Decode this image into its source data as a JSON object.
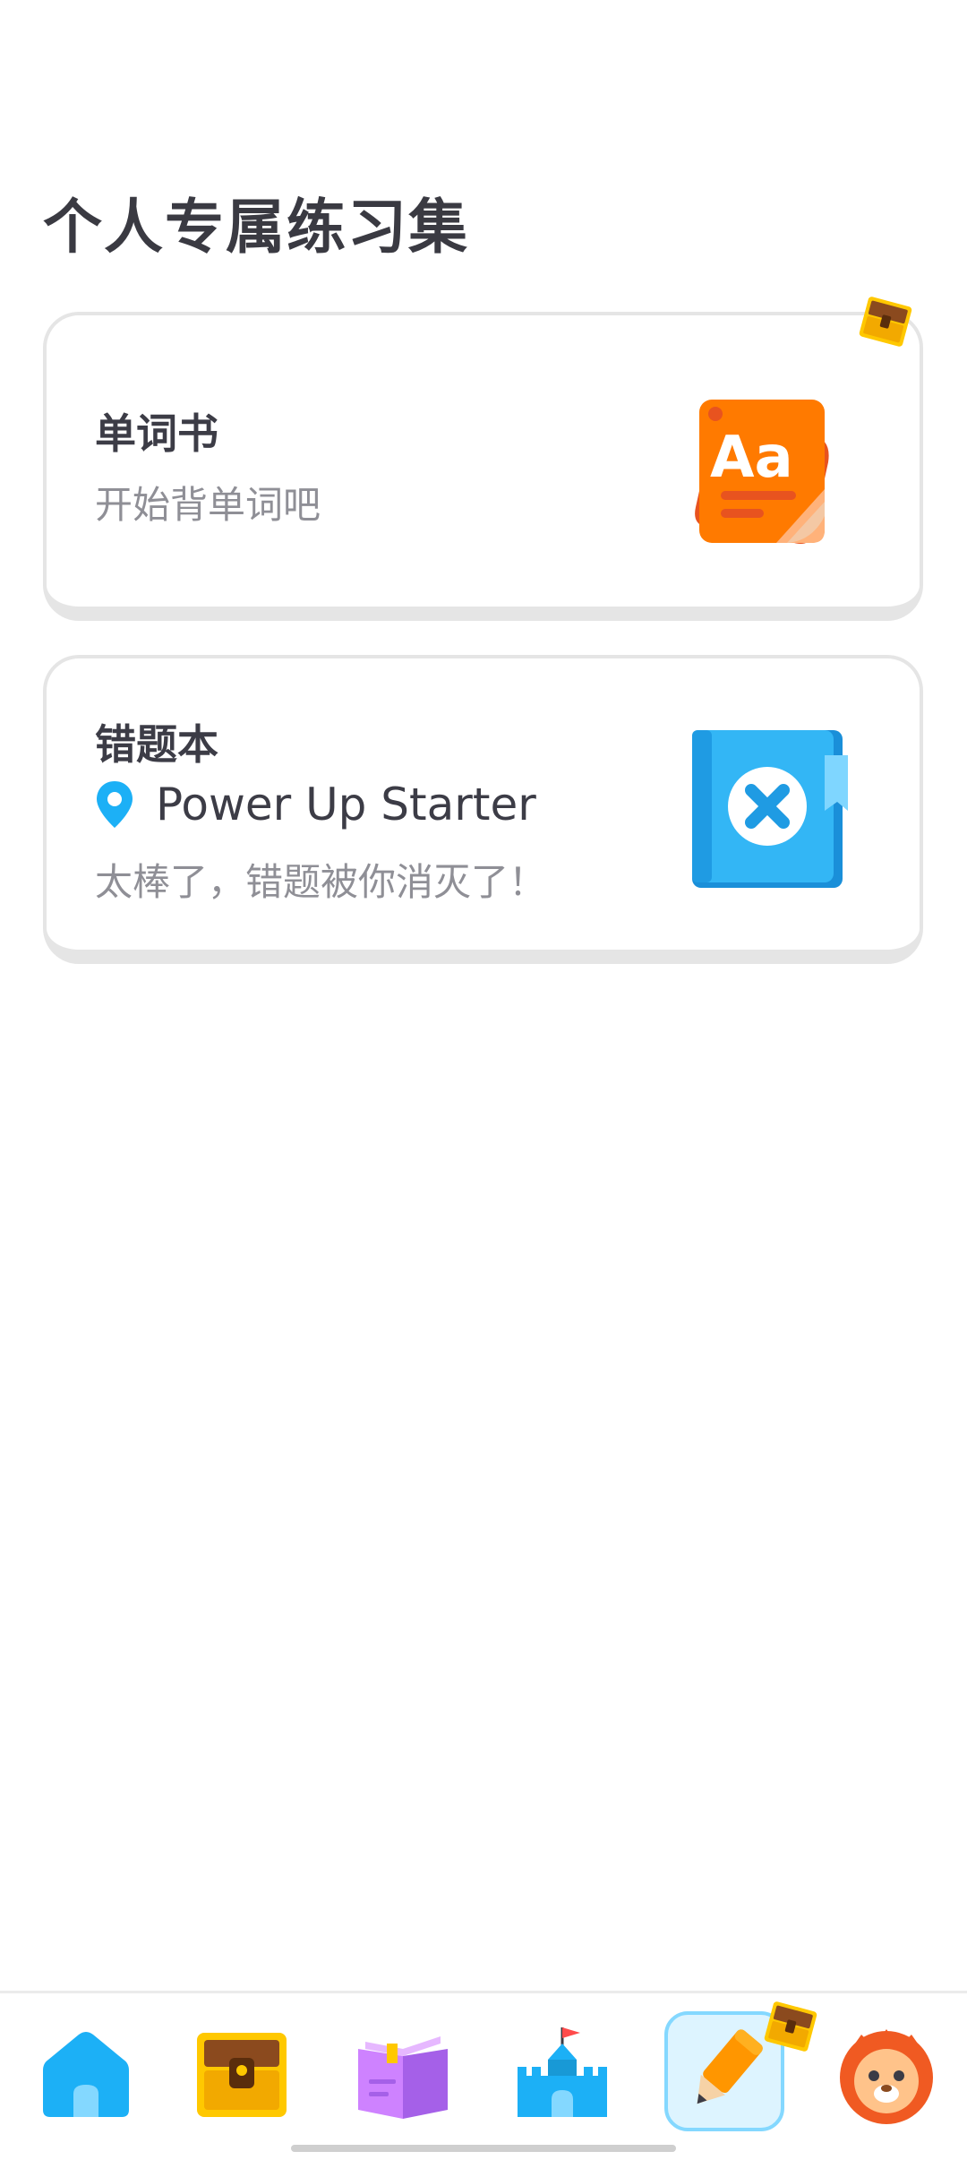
{
  "page": {
    "title": "个人专属练习集"
  },
  "cards": {
    "wordbook": {
      "title": "单词书",
      "subtitle": "开始背单词吧",
      "icon": "aa-wordbook-icon",
      "badge_icon": "chest-icon"
    },
    "mistakes": {
      "title": "错题本",
      "location": "Power Up Starter",
      "location_icon": "map-pin-icon",
      "subtitle": "太棒了，错题被你消灭了！",
      "icon": "mistake-notebook-icon"
    }
  },
  "nav": {
    "items": [
      {
        "name": "home",
        "icon": "home-icon"
      },
      {
        "name": "chest",
        "icon": "chest-icon"
      },
      {
        "name": "stories",
        "icon": "book-icon"
      },
      {
        "name": "leagues",
        "icon": "castle-icon"
      },
      {
        "name": "practice",
        "icon": "pencil-icon",
        "selected": true
      },
      {
        "name": "profile",
        "icon": "lion-avatar-icon"
      }
    ]
  },
  "colors": {
    "accent_blue": "#1cb0f6",
    "selected_bg": "#ddf4ff",
    "selected_border": "#84d8ff",
    "card_border": "#e5e5e5",
    "subtitle_gray": "#8f8f96",
    "orange": "#ff7a00",
    "notebook_blue": "#33b6f5"
  }
}
